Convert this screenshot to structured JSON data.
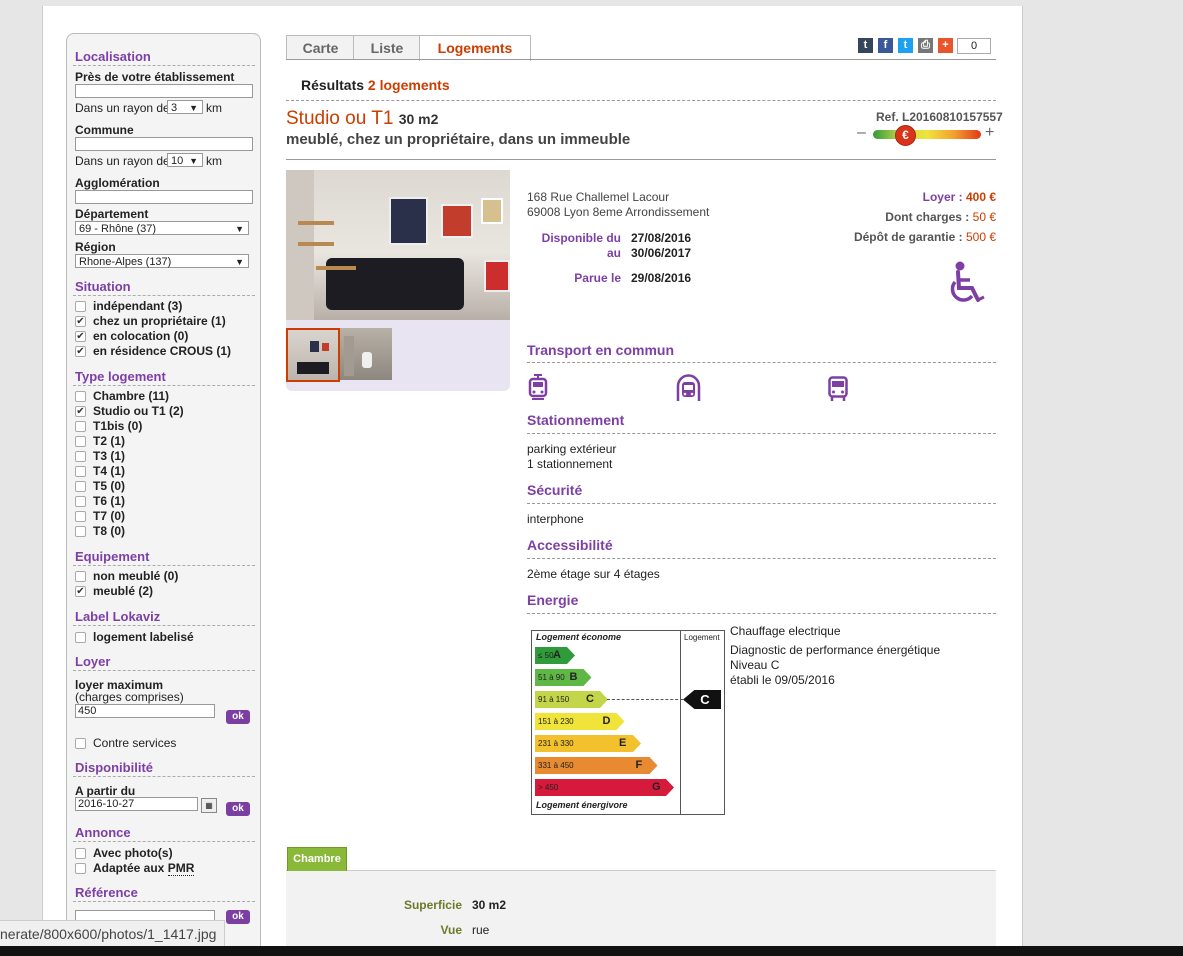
{
  "sidebar": {
    "localisation": {
      "heading": "Localisation",
      "etab_label": "Près de votre établissement",
      "radius_prefix": "Dans un rayon de",
      "radius1": "3",
      "km": "km",
      "commune_label": "Commune",
      "radius2": "10",
      "agglo_label": "Agglomération",
      "dept_label": "Département",
      "dept_value": "69 - Rhône (37)",
      "region_label": "Région",
      "region_value": "Rhone-Alpes (137)"
    },
    "situation": {
      "heading": "Situation",
      "items": [
        {
          "label": "indépendant (3)",
          "checked": false
        },
        {
          "label": "chez un propriétaire (1)",
          "checked": true
        },
        {
          "label": "en colocation (0)",
          "checked": true
        },
        {
          "label": "en résidence CROUS (1)",
          "checked": true
        }
      ]
    },
    "type": {
      "heading": "Type logement",
      "items": [
        {
          "label": "Chambre (11)",
          "checked": false
        },
        {
          "label": "Studio ou T1 (2)",
          "checked": true
        },
        {
          "label": "T1bis (0)",
          "checked": false
        },
        {
          "label": "T2 (1)",
          "checked": false
        },
        {
          "label": "T3 (1)",
          "checked": false
        },
        {
          "label": "T4 (1)",
          "checked": false
        },
        {
          "label": "T5 (0)",
          "checked": false
        },
        {
          "label": "T6 (1)",
          "checked": false
        },
        {
          "label": "T7 (0)",
          "checked": false
        },
        {
          "label": "T8 (0)",
          "checked": false
        }
      ]
    },
    "equipement": {
      "heading": "Equipement",
      "items": [
        {
          "label": "non meublé (0)",
          "checked": false
        },
        {
          "label": "meublé (2)",
          "checked": true
        }
      ]
    },
    "label": {
      "heading": "Label Lokaviz",
      "item": "logement labelisé"
    },
    "loyer": {
      "heading": "Loyer",
      "max_label": "loyer maximum",
      "charges_note": "(charges comprises)",
      "value": "450",
      "ok": "ok",
      "contre": "Contre services"
    },
    "dispo": {
      "heading": "Disponibilité",
      "label": "A partir du",
      "value": "2016-10-27",
      "ok": "ok"
    },
    "annonce": {
      "heading": "Annonce",
      "photos": "Avec photo(s)",
      "pmr_prefix": "Adaptée aux ",
      "pmr": "PMR"
    },
    "reference": {
      "heading": "Référence",
      "ok": "ok"
    }
  },
  "tabs": [
    "Carte",
    "Liste",
    "Logements"
  ],
  "social": {
    "icons": [
      "tumblr-icon",
      "facebook-icon",
      "twitter-icon",
      "print-icon",
      "plus-icon"
    ],
    "letters": [
      "t",
      "f",
      "t",
      "⎙",
      "+"
    ],
    "colors": [
      "#35465c",
      "#3b5998",
      "#1da1f2",
      "#777777",
      "#e8542c"
    ],
    "count": "0"
  },
  "results": {
    "prefix": "Résultats",
    "count": "2 logements"
  },
  "listing": {
    "title": "Studio ou T1",
    "area": "30 m2",
    "subtitle": "meublé, chez un propriétaire, dans un immeuble",
    "ref": "Ref. L20160810157557",
    "price_meter_symbol": "€",
    "minus": "–",
    "plus": "+",
    "address1": "168 Rue Challemel Lacour",
    "address2": "69008 Lyon 8eme Arrondissement",
    "dispo_label": "Disponible du",
    "au_label": "au",
    "dispo_from": "27/08/2016",
    "dispo_to": "30/06/2017",
    "parue_label": "Parue le",
    "parue": "29/08/2016",
    "loyer_label": "Loyer :",
    "loyer": "400 €",
    "charges_label": "Dont charges :",
    "charges": "50 €",
    "depot_label": "Dépôt de garantie :",
    "depot": "500 €"
  },
  "sections": {
    "transport": "Transport en commun",
    "stationnement": "Stationnement",
    "parking1": "parking extérieur",
    "parking2": "1 stationnement",
    "securite": "Sécurité",
    "securite_val": "interphone",
    "accessibilite": "Accessibilité",
    "access_val": "2ème étage sur 4 étages",
    "energie": "Energie"
  },
  "energy": {
    "top": "Logement économe",
    "bottom": "Logement énergivore",
    "col": "Logement",
    "current": "C",
    "bars": [
      {
        "range": "≤ 50",
        "letter": "A",
        "color": "#2f9b3a"
      },
      {
        "range": "51 à 90",
        "letter": "B",
        "color": "#5fb845"
      },
      {
        "range": "91 à 150",
        "letter": "C",
        "color": "#c3d64a"
      },
      {
        "range": "151 à 230",
        "letter": "D",
        "color": "#f0e43a"
      },
      {
        "range": "231 à 330",
        "letter": "E",
        "color": "#f3c02e"
      },
      {
        "range": "331 à 450",
        "letter": "F",
        "color": "#e88a32"
      },
      {
        "range": "> 450",
        "letter": "G",
        "color": "#d61a3c"
      }
    ],
    "info1": "Chauffage electrique",
    "info2": "Diagnostic de performance énergétique",
    "info3": "Niveau C",
    "info4": "établi le 09/05/2016"
  },
  "chambre": {
    "tab": "Chambre",
    "superficie_label": "Superficie",
    "superficie": "30 m2",
    "vue_label": "Vue",
    "vue": "rue"
  },
  "status_url": "nerate/800x600/photos/1_1417.jpg"
}
